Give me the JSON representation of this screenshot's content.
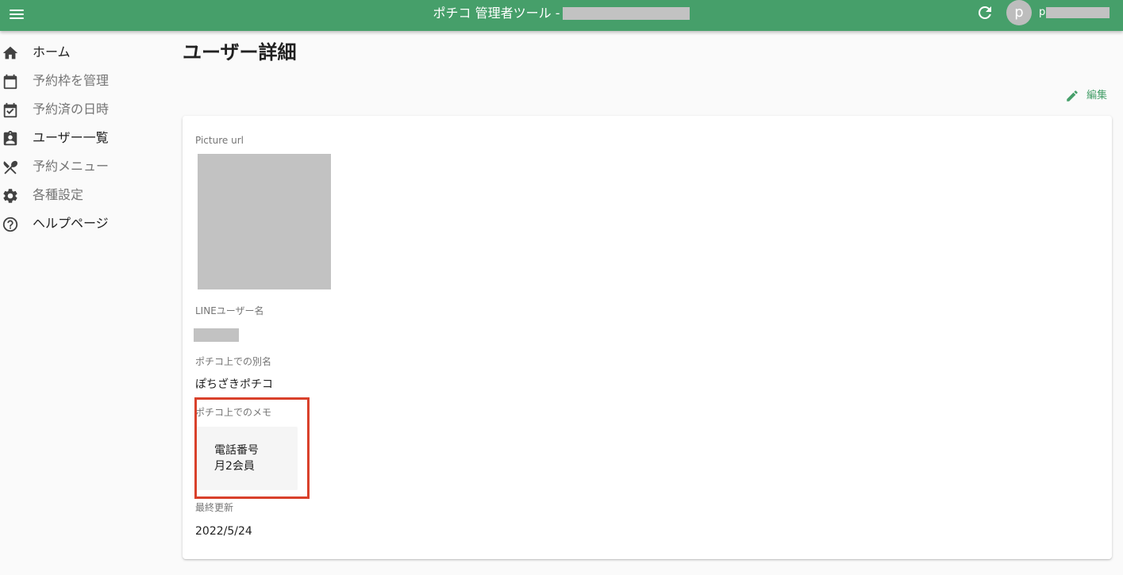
{
  "header": {
    "title": "ポチコ 管理者ツール -",
    "avatar_initial": "p",
    "user_name": "p"
  },
  "sidebar": {
    "items": [
      {
        "label": "ホーム",
        "icon": "home-icon"
      },
      {
        "label": "予約枠を管理",
        "icon": "calendar-icon"
      },
      {
        "label": "予約済の日時",
        "icon": "calendar-check-icon"
      },
      {
        "label": "ユーザー一覧",
        "icon": "account-box-icon"
      },
      {
        "label": "予約メニュー",
        "icon": "silverware-icon"
      },
      {
        "label": "各種設定",
        "icon": "gear-icon"
      },
      {
        "label": "ヘルプページ",
        "icon": "help-circle-icon"
      }
    ]
  },
  "main": {
    "title": "ユーザー詳細",
    "edit_label": "編集",
    "fields": {
      "picture_label": "Picture url",
      "line_name_label": "LINEユーザー名",
      "alias_label": "ポチコ上での別名",
      "alias_value": "ぽちざきポチコ",
      "memo_label": "ポチコ上でのメモ",
      "memo_lines": [
        "電話番号",
        "月2会員"
      ],
      "updated_label": "最終更新",
      "updated_value": "2022/5/24"
    }
  },
  "colors": {
    "appbar": "#469f6a",
    "accent": "#469f6a",
    "highlight": "#d9412b",
    "redaction": "#c2c2c2"
  }
}
